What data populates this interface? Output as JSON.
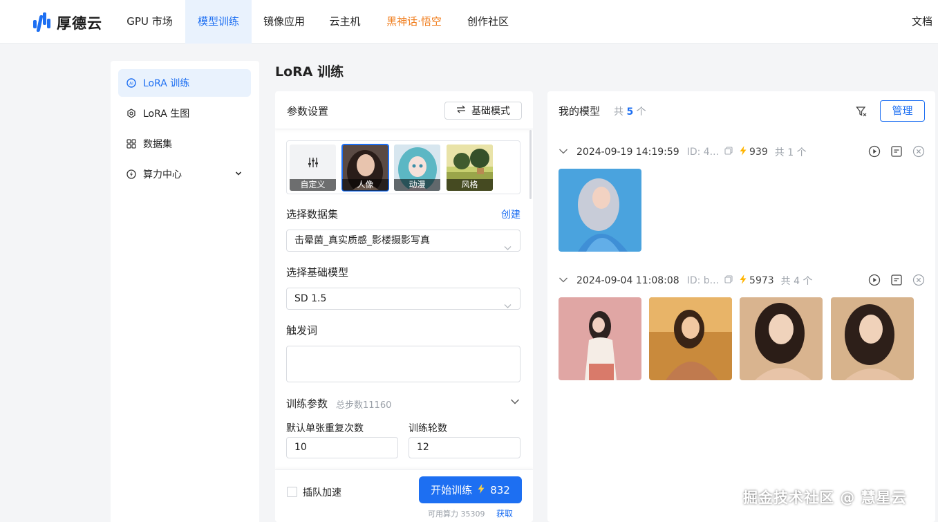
{
  "app": {
    "brand": "厚德云"
  },
  "nav": {
    "items": [
      "GPU 市场",
      "模型训练",
      "镜像应用",
      "云主机",
      "黑神话·悟空",
      "创作社区"
    ],
    "docs": "文档"
  },
  "sidebar": {
    "items": [
      {
        "label": "LoRA 训练",
        "icon": "lora-train-icon"
      },
      {
        "label": "LoRA 生图",
        "icon": "lora-image-icon"
      },
      {
        "label": "数据集",
        "icon": "dataset-grid-icon"
      },
      {
        "label": "算力中心",
        "icon": "power-bolt-icon"
      }
    ]
  },
  "page": {
    "title": "LoRA 训练"
  },
  "params": {
    "title": "参数设置",
    "mode_label": "基础模式",
    "presets": [
      "自定义",
      "人像",
      "动漫",
      "风格"
    ],
    "dataset_label": "选择数据集",
    "dataset_create": "创建",
    "dataset_value": "击晕菌_真实质感_影楼摄影写真",
    "model_label": "选择基础模型",
    "model_value": "SD 1.5",
    "trigger_label": "触发词",
    "trigger_value": "",
    "section_title": "训练参数",
    "section_sub": "总步数11160",
    "repeat_label": "默认单张重复次数",
    "repeat_value": "10",
    "epoch_label": "训练轮数",
    "epoch_value": "12",
    "queue_label": "插队加速",
    "start_label": "开始训练",
    "start_cost": "832",
    "power_text": "可用算力 35309",
    "power_link": "获取"
  },
  "models": {
    "title": "我的模型",
    "count_prefix": "共",
    "count_value": "5",
    "count_suffix": "个",
    "manage_label": "管理",
    "groups": [
      {
        "date": "2024-09-19 14:19:59",
        "id": "ID: 4...",
        "power": "939",
        "count": "共 1 个"
      },
      {
        "date": "2024-09-04 11:08:08",
        "id": "ID: b...",
        "power": "5973",
        "count": "共 4 个"
      }
    ]
  },
  "watermark": "掘金技术社区 @ 慧星云",
  "colors": {
    "accent": "#1d6ff2",
    "highlight": "#f07c1b",
    "bolt": "#ffb400"
  }
}
